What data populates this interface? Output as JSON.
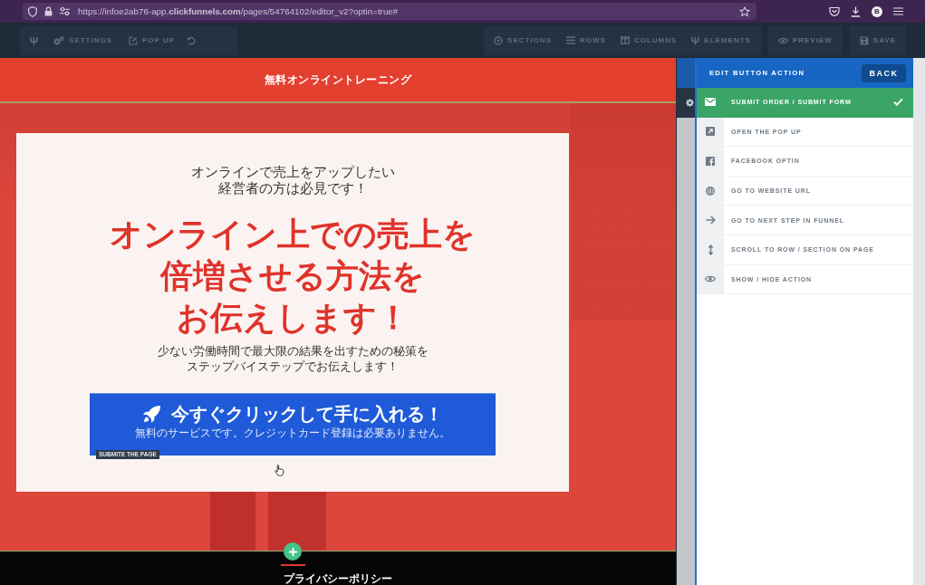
{
  "browser": {
    "url": "https://infoe2ab76-app.**clickfunnels.com**/pages/54764102/editor_v2?optin=true#",
    "account_initial": "B"
  },
  "toolbar": {
    "left_items": [
      {
        "label": "SETTINGS"
      },
      {
        "label": "POP UP"
      }
    ],
    "right_groups": [
      [
        {
          "label": "SECTIONS"
        },
        {
          "label": "ROWS"
        },
        {
          "label": "COLUMNS"
        },
        {
          "label": "ELEMENTS"
        }
      ],
      [
        {
          "label": "PREVIEW"
        }
      ],
      [
        {
          "label": "SAVE"
        }
      ]
    ]
  },
  "canvas": {
    "header_title": "無料オンライントレーニング",
    "intro_lines": [
      "オンラインで売上をアップしたい",
      "経営者の方は必見です！"
    ],
    "headline_lines": [
      "オンライン上での売上を",
      "倍増させる方法を",
      "お伝えします！"
    ],
    "subtext_lines": [
      "少ない労働時間で最大限の結果を出すための秘策を",
      "ステップバイステップでお伝えします！"
    ],
    "cta_button": {
      "label": "今すぐクリックして手に入れる！",
      "subtext": "無料のサービスです。クレジットカード登録は必要ありません。",
      "tag": "SUBMITE THE PAGE"
    },
    "footer_link": "プライバシーポリシー"
  },
  "action_panel": {
    "title": "EDIT BUTTON ACTION",
    "back_button": "BACK",
    "actions": [
      {
        "label": "SUBMIT ORDER / SUBMIT FORM",
        "selected": true
      },
      {
        "label": "OPEN THE POP UP",
        "selected": false
      },
      {
        "label": "FACEBOOK OPTIN",
        "selected": false
      },
      {
        "label": "GO TO WEBSITE URL",
        "selected": false
      },
      {
        "label": "GO TO NEXT STEP IN FUNNEL",
        "selected": false
      },
      {
        "label": "SCROLL TO ROW / SECTION ON PAGE",
        "selected": false
      },
      {
        "label": "SHOW / HIDE ACTION",
        "selected": false
      }
    ]
  }
}
